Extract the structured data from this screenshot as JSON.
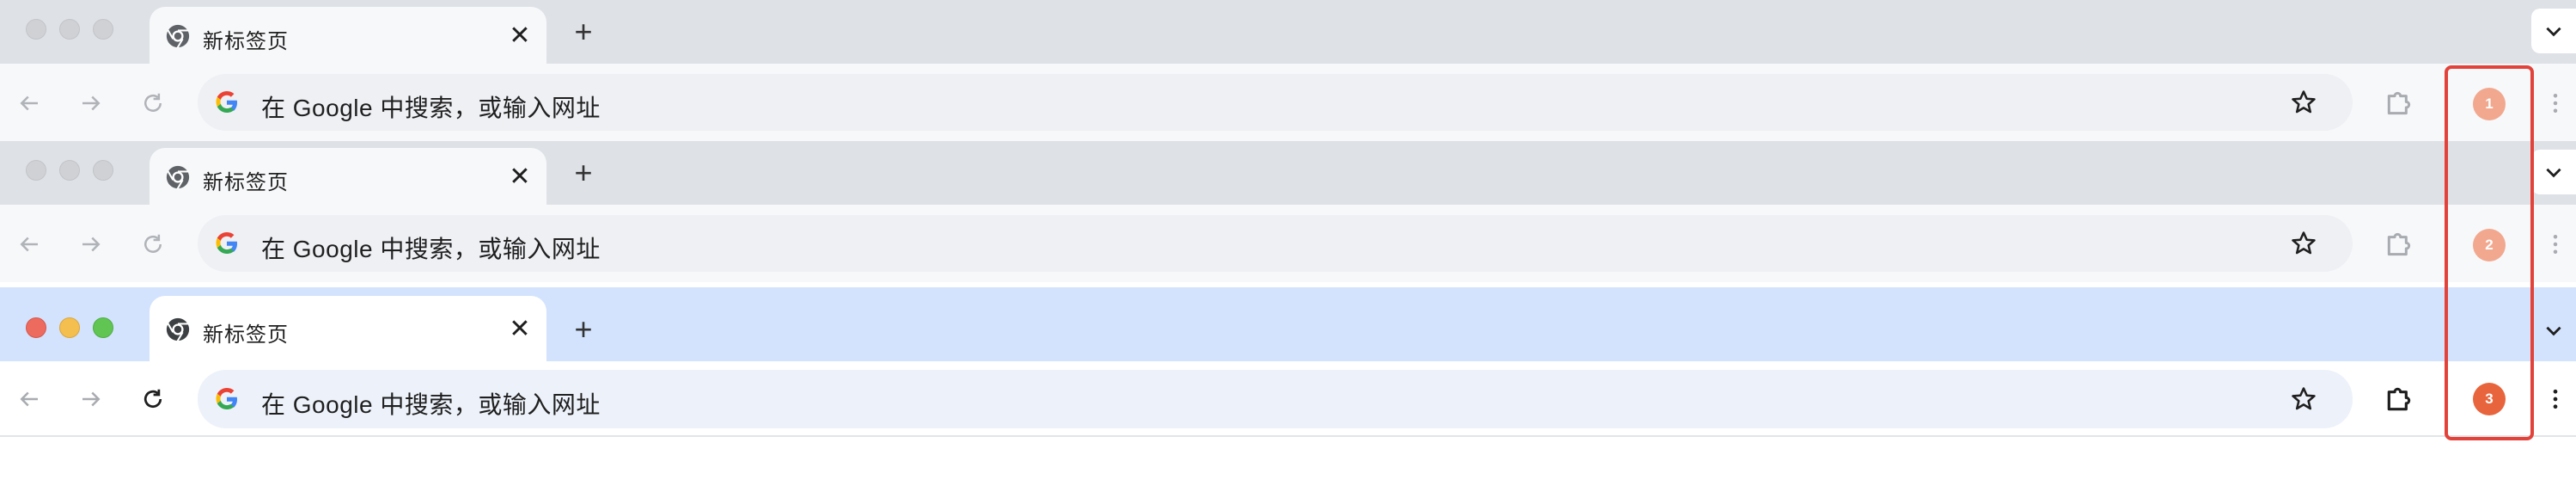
{
  "tab": {
    "title": "新标签页",
    "close_glyph": "✕",
    "new_tab_glyph": "+"
  },
  "omnibox": {
    "text": "在 Google 中搜索，或输入网址"
  },
  "windows": [
    {
      "state": "inactive",
      "profile_number": "1",
      "profile_color": "#f2a88f"
    },
    {
      "state": "inactive",
      "profile_number": "2",
      "profile_color": "#f2a88f"
    },
    {
      "state": "active",
      "profile_number": "3",
      "profile_color": "#e8643c"
    }
  ],
  "icons": {
    "favicon": "chrome-icon",
    "search": "google-g-icon",
    "bookmark": "star-icon",
    "extensions": "puzzle-icon",
    "menu": "kebab-icon",
    "tab_list": "chevron-down-icon"
  },
  "colors": {
    "inactive_tabstrip": "#dee1e6",
    "active_tabstrip": "#d3e3fd",
    "highlight_box": "#e2423a"
  }
}
